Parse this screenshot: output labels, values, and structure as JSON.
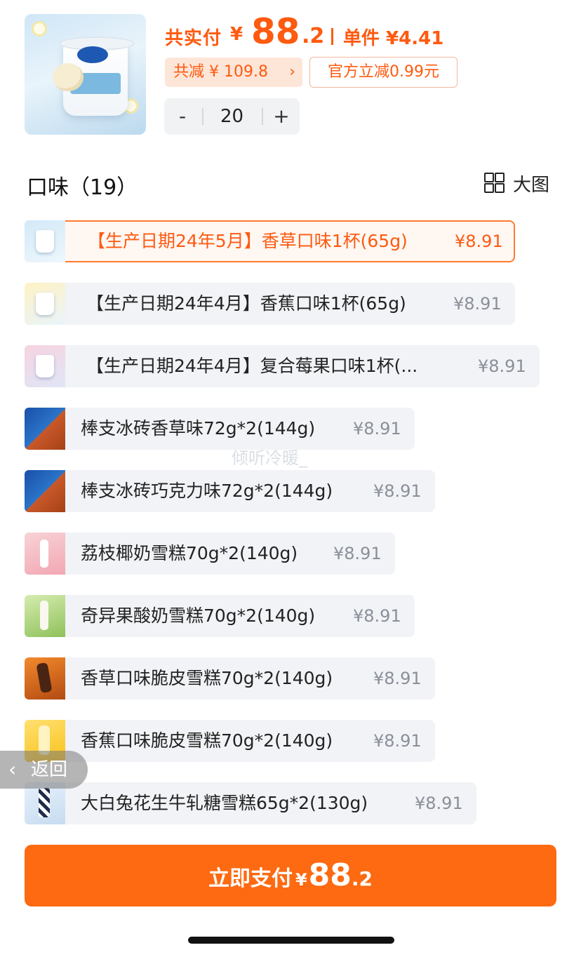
{
  "header": {
    "paid_label": "共实付",
    "yen": "¥",
    "paid_int": "88",
    "paid_dec": ".2",
    "unit_label": "单件 ¥4.41",
    "save_label": "共减 ¥ 109.8",
    "save_chevron": "›",
    "official_label": "官方立减0.99元"
  },
  "stepper": {
    "minus": "-",
    "qty": "20",
    "plus": "+"
  },
  "flavors": {
    "title": "口味（19）",
    "bigpic_label": "大图",
    "options": [
      {
        "name": "【生产日期24年5月】香草口味1杯(65g)",
        "price": "¥8.91",
        "selected": true
      },
      {
        "name": "【生产日期24年4月】香蕉口味1杯(65g)",
        "price": "¥8.91",
        "selected": false
      },
      {
        "name": "【生产日期24年4月】复合莓果口味1杯(...",
        "price": "¥8.91",
        "selected": false
      },
      {
        "name": "棒支冰砖香草味72g*2(144g)",
        "price": "¥8.91",
        "selected": false
      },
      {
        "name": "棒支冰砖巧克力味72g*2(144g)",
        "price": "¥8.91",
        "selected": false
      },
      {
        "name": "荔枝椰奶雪糕70g*2(140g)",
        "price": "¥8.91",
        "selected": false
      },
      {
        "name": "奇异果酸奶雪糕70g*2(140g)",
        "price": "¥8.91",
        "selected": false
      },
      {
        "name": "香草口味脆皮雪糕70g*2(140g)",
        "price": "¥8.91",
        "selected": false
      },
      {
        "name": "香蕉口味脆皮雪糕70g*2(140g)",
        "price": "¥8.91",
        "selected": false
      },
      {
        "name": "大白兔花生牛轧糖雪糕65g*2(130g)",
        "price": "¥8.91",
        "selected": false
      }
    ]
  },
  "watermark": "倾听冷暖_",
  "back": {
    "label": "返回",
    "icon": "chevron-left-icon"
  },
  "pay": {
    "label": "立即支付",
    "yen": "¥",
    "int": "88",
    "dec": ".2"
  },
  "colors": {
    "accent": "#fe5a10",
    "button": "#fd6a12"
  }
}
